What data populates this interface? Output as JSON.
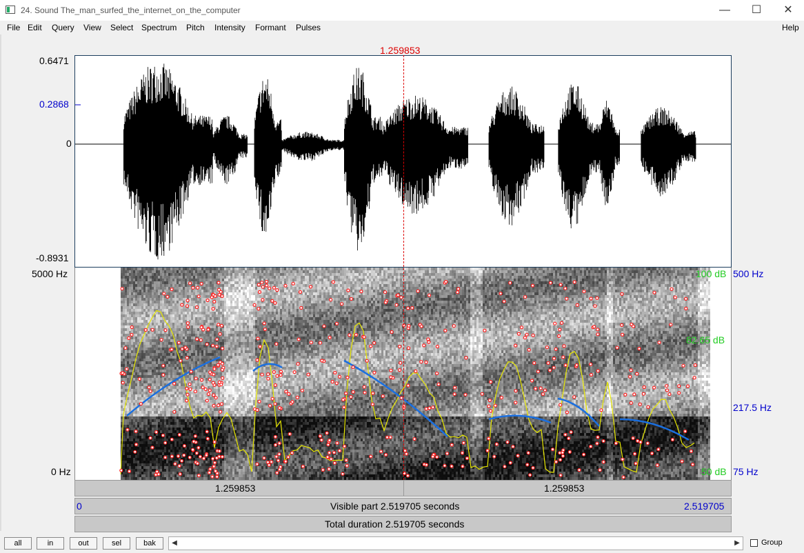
{
  "window": {
    "title": "24. Sound The_man_surfed_the_internet_on_the_computer",
    "minimize_glyph": "—",
    "maximize_glyph": "☐",
    "close_glyph": "✕"
  },
  "menu": {
    "items": [
      "File",
      "Edit",
      "Query",
      "View",
      "Select",
      "Spectrum",
      "Pitch",
      "Intensity",
      "Formant",
      "Pulses"
    ],
    "help": "Help"
  },
  "cursor": {
    "time": "1.259853",
    "position_fraction": 0.4999
  },
  "waveform": {
    "y_max": "0.6471",
    "y_mark": "0.2868",
    "y_zero": "0",
    "y_min": "-0.8931"
  },
  "spectrogram": {
    "freq_max": "5000 Hz",
    "freq_min": "0 Hz",
    "intensity_max": "100 dB",
    "intensity_mark": "82.65 dB",
    "intensity_min": "50 dB",
    "pitch_max": "500 Hz",
    "pitch_mark": "217.5 Hz",
    "pitch_min": "75 Hz"
  },
  "time_bars": {
    "left_segment": "1.259853",
    "right_segment": "1.259853",
    "visible_start": "0",
    "visible_label": "Visible part 2.519705 seconds",
    "visible_end": "2.519705",
    "total_label": "Total duration 2.519705 seconds"
  },
  "bottom": {
    "buttons": [
      "all",
      "in",
      "out",
      "sel",
      "bak"
    ],
    "scroll_left": "◀",
    "scroll_right": "▶",
    "group_label": "Group",
    "group_checked": false
  },
  "colors": {
    "cursor": "#dd0000",
    "axis_blue": "#0000cc",
    "intensity_green": "#22cc22",
    "pitch_blue": "#1a6fe0",
    "intensity_curve": "#e8e800",
    "formant_dot": "#ff2020"
  }
}
